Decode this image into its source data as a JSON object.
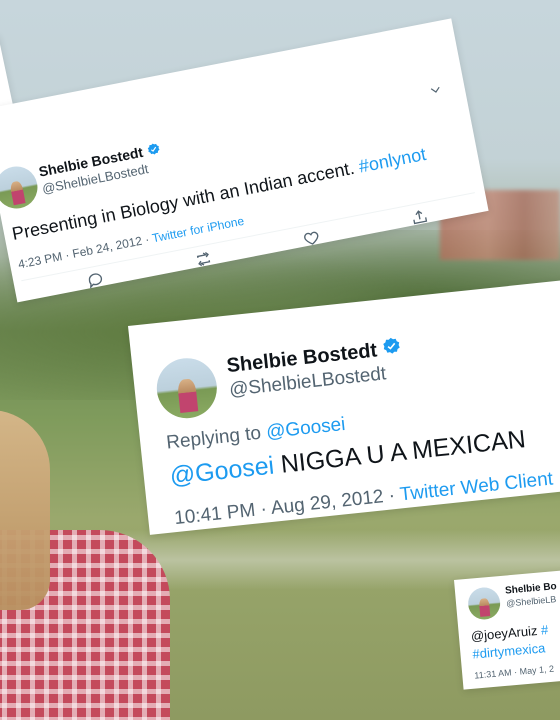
{
  "tweets": [
    {
      "name": "Shelbie Bostedt",
      "handle": "@ShelbieLBostedt",
      "text": "Presenting in Biology with an Indian accent.",
      "hashtag": "#onlynot",
      "time": "4:23 PM · Feb 24, 2012 · ",
      "source": "Twitter for iPhone",
      "actions": [
        "reply-icon",
        "retweet-icon",
        "like-icon",
        "share-icon"
      ]
    },
    {
      "name": "Shelbie Bostedt",
      "handle": "@ShelbieLBostedt",
      "replying_prefix": "Replying to ",
      "replying_to": "@Goosei",
      "mention": "@Goosei",
      "text": " NIGGA U A MEXICAN",
      "time": "10:41 PM · Aug 29, 2012 · ",
      "source": "Twitter Web Client"
    },
    {
      "name": "Shelbie Bo",
      "handle": "@ShelbieLB",
      "mention": "@joeyAruiz",
      "hashtag_partial": " #",
      "hashtag2": "#dirtymexica",
      "time": "11:31 AM · May 1, 2"
    }
  ],
  "colors": {
    "link": "#1d9bf0",
    "verified": "#1d9bf0",
    "muted": "#536471"
  }
}
